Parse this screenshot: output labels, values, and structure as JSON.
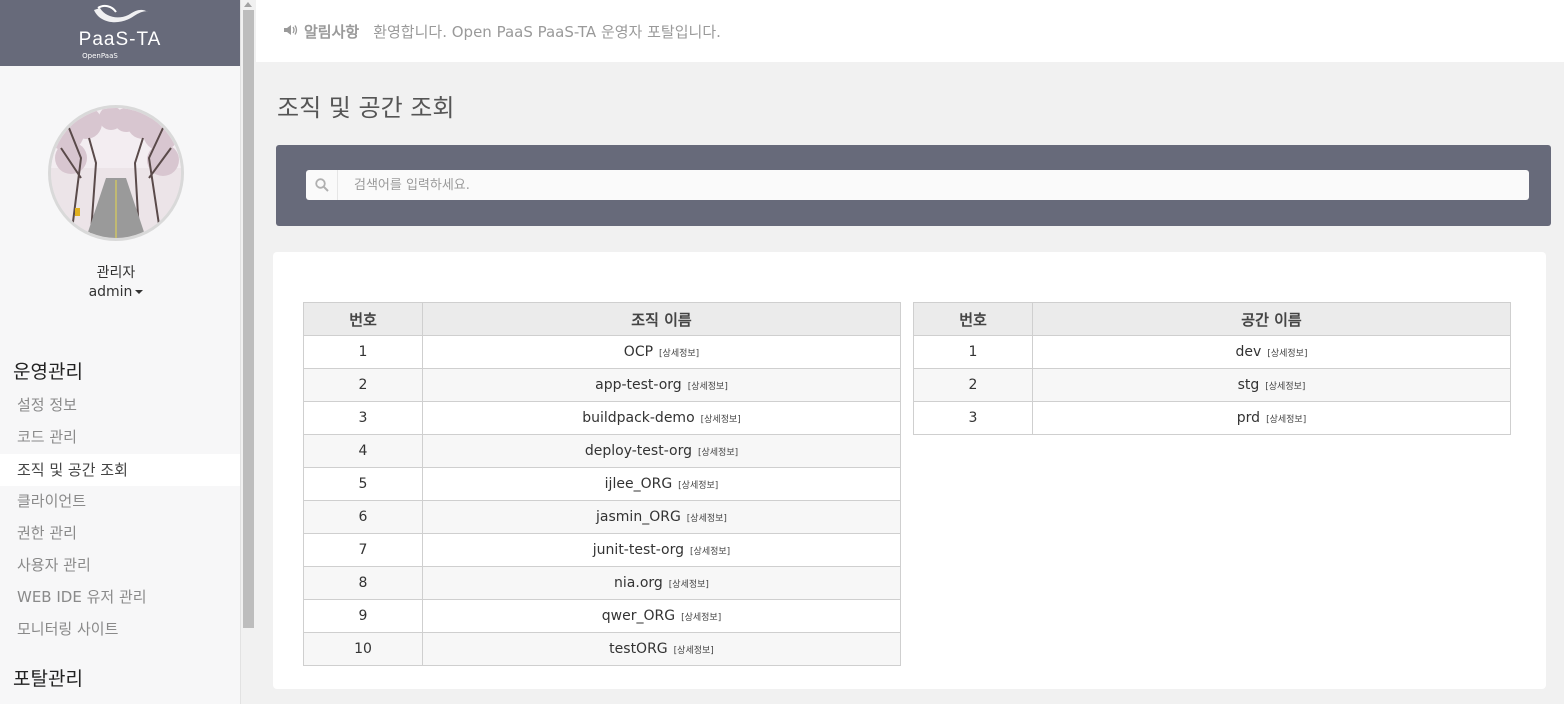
{
  "logo": {
    "title": "PaaS-TA",
    "subtitle": "OpenPaaS"
  },
  "user": {
    "role": "관리자",
    "name": "admin"
  },
  "sidebar": {
    "sections": [
      {
        "heading": "운영관리",
        "items": [
          {
            "label": "설정 정보",
            "active": false
          },
          {
            "label": "코드 관리",
            "active": false
          },
          {
            "label": "조직 및 공간 조회",
            "active": true
          },
          {
            "label": "클라이언트",
            "active": false
          },
          {
            "label": "권한 관리",
            "active": false
          },
          {
            "label": "사용자 관리",
            "active": false
          },
          {
            "label": "WEB IDE 유저 관리",
            "active": false
          },
          {
            "label": "모니터링 사이트",
            "active": false
          }
        ]
      },
      {
        "heading": "포탈관리"
      }
    ]
  },
  "notice": {
    "label": "알림사항",
    "text": "환영합니다. Open PaaS PaaS-TA 운영자 포탈입니다."
  },
  "page": {
    "title": "조직 및 공간 조회"
  },
  "search": {
    "placeholder": "검색어를 입력하세요."
  },
  "detail_label": "[상세정보]",
  "org_table": {
    "headers": [
      "번호",
      "조직 이름"
    ],
    "rows": [
      {
        "num": "1",
        "name": "OCP"
      },
      {
        "num": "2",
        "name": "app-test-org"
      },
      {
        "num": "3",
        "name": "buildpack-demo"
      },
      {
        "num": "4",
        "name": "deploy-test-org"
      },
      {
        "num": "5",
        "name": "ijlee_ORG"
      },
      {
        "num": "6",
        "name": "jasmin_ORG"
      },
      {
        "num": "7",
        "name": "junit-test-org"
      },
      {
        "num": "8",
        "name": "nia.org"
      },
      {
        "num": "9",
        "name": "qwer_ORG"
      },
      {
        "num": "10",
        "name": "testORG"
      }
    ]
  },
  "space_table": {
    "headers": [
      "번호",
      "공간 이름"
    ],
    "rows": [
      {
        "num": "1",
        "name": "dev"
      },
      {
        "num": "2",
        "name": "stg"
      },
      {
        "num": "3",
        "name": "prd"
      }
    ]
  },
  "colors": {
    "header_bar": "#676a7a",
    "sidebar_bg": "#f7f7f8",
    "page_bg": "#f1f1f1"
  }
}
